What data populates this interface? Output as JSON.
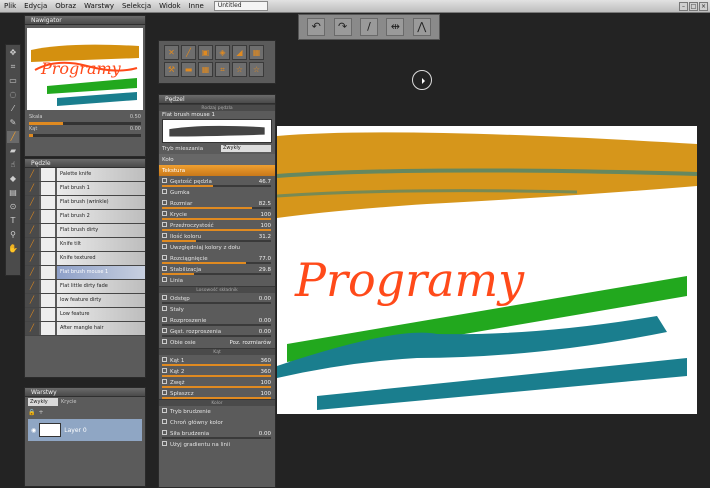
{
  "menubar": {
    "items": [
      "Plik",
      "Edycja",
      "Obraz",
      "Warstwy",
      "Selekcja",
      "Widok",
      "Inne"
    ],
    "document_tab": "Untitled"
  },
  "navigator": {
    "title": "Nawigator",
    "thumb_text": "Programy",
    "skala_label": "Skala",
    "skala_value": "0.50",
    "kat_label": "Kąt",
    "kat_value": "0.00"
  },
  "brushes": {
    "title": "Pędzle",
    "items": [
      "Palette knife",
      "Flat brush 1",
      "Flat brush (wrinkle)",
      "Flat brush 2",
      "Flat brush dirty",
      "Knife tilt",
      "Knife textured",
      "Flat brush mouse 1",
      "Flat little dirty fade",
      "low feature dirty",
      "Low feature",
      "After mangle hair"
    ],
    "selected_index": 7
  },
  "layers": {
    "title": "Warstwy",
    "mode": "Zwykły",
    "opacity_label": "Krycie",
    "layer_name": "Layer 0"
  },
  "props": {
    "title": "Pędzel",
    "section_brush": "Rodzaj pędzla",
    "brush_name": "Flat brush mouse 1",
    "mode_label": "Tryb mieszania",
    "mode_value": "Zwykły",
    "opt_kolo": "Koło",
    "opt_tekstura": "Tekstura",
    "rows": [
      {
        "label": "Gęstość pędzla",
        "value": "46.7"
      },
      {
        "label": "Gumka",
        "value": ""
      },
      {
        "label": "Rozmiar",
        "value": "82.5"
      },
      {
        "label": "Krycie",
        "value": "100"
      },
      {
        "label": "Przeźroczystość",
        "value": "100"
      },
      {
        "label": "Ilość koloru",
        "value": "31.2"
      },
      {
        "label": "Uwzględniaj kolory z dołu",
        "value": ""
      },
      {
        "label": "Rozciągnięcie",
        "value": "77.0"
      },
      {
        "label": "Stabilizacja",
        "value": "29.8"
      },
      {
        "label": "Linia",
        "value": ""
      }
    ],
    "section_touch": "Losowość składnik",
    "rows2": [
      {
        "label": "Odstęp",
        "value": "0.00"
      },
      {
        "label": "Stały",
        "value": ""
      },
      {
        "label": "Rozproszenie",
        "value": "0.00"
      },
      {
        "label": "Gęst. rozproszenia",
        "value": "0.00"
      },
      {
        "label": "Obie osie",
        "value": "Poz. rozmiarów"
      }
    ],
    "section_tilt": "Kąt",
    "rows3": [
      {
        "label": "Kąt 1",
        "value": "360"
      },
      {
        "label": "Kąt 2",
        "value": "360"
      },
      {
        "label": "Zwęż",
        "value": "100"
      },
      {
        "label": "Spłaszcz",
        "value": "100"
      }
    ],
    "section_color": "Kolor",
    "rows4": [
      {
        "label": "Tryb brudzenie",
        "value": ""
      },
      {
        "label": "Chroń główny kolor",
        "value": ""
      },
      {
        "label": "Siła brudzenia",
        "value": "0.00"
      },
      {
        "label": "Użyj gradientu na linii",
        "value": ""
      }
    ]
  },
  "colors": {
    "accent": "#e08a20",
    "stroke_ochre": "#d4900f",
    "stroke_red": "#ff4a1a",
    "stroke_green": "#22a81e",
    "stroke_teal": "#1a7e8e"
  }
}
